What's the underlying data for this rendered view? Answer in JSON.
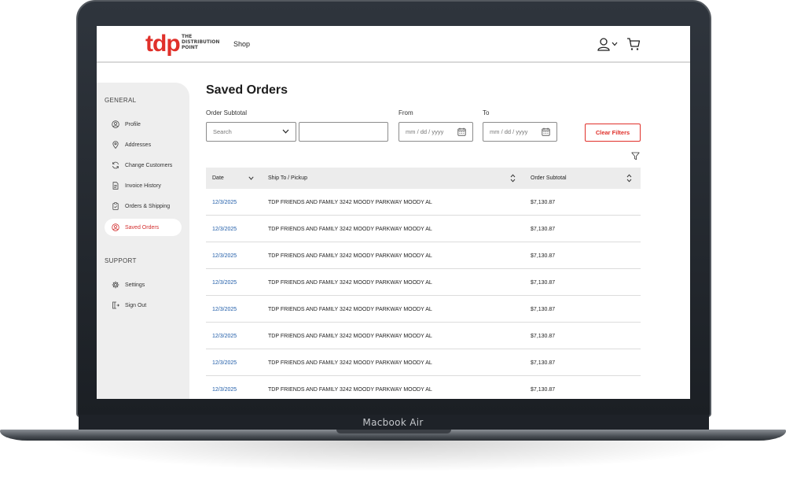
{
  "device": {
    "label": "Macbook Air"
  },
  "header": {
    "logo_mark": "tdp",
    "logo_text_line1": "THE",
    "logo_text_line2": "DISTRIBUTION",
    "logo_text_line3": "POINT",
    "shop_label": "Shop"
  },
  "sidebar": {
    "general_heading": "GENERAL",
    "support_heading": "SUPPORT",
    "items": [
      {
        "label": "Profile",
        "icon": "user-circle-icon"
      },
      {
        "label": "Addresses",
        "icon": "map-pin-icon"
      },
      {
        "label": "Change Customers",
        "icon": "refresh-icon"
      },
      {
        "label": "Invoice History",
        "icon": "document-icon"
      },
      {
        "label": "Orders & Shipping",
        "icon": "clipboard-icon"
      },
      {
        "label": "Saved Orders",
        "icon": "saved-orders-icon",
        "active": true
      }
    ],
    "support_items": [
      {
        "label": "Settings",
        "icon": "gear-icon"
      },
      {
        "label": "Sign Out",
        "icon": "sign-out-icon"
      }
    ]
  },
  "main": {
    "title": "Saved Orders",
    "filters": {
      "subtotal_label": "Order Subtotal",
      "search_placeholder": "Search",
      "from_label": "From",
      "to_label": "To",
      "date_placeholder": "mm / dd / yyyy",
      "clear_label": "Clear Filters"
    },
    "table": {
      "columns": [
        "Date",
        "Ship To / Pickup",
        "Order Subtotal"
      ],
      "rows": [
        {
          "date": "12/3/2025",
          "ship_to": "TDP FRIENDS AND FAMILY 3242 MOODY PARKWAY MOODY AL",
          "subtotal": "$7,130.87"
        },
        {
          "date": "12/3/2025",
          "ship_to": "TDP FRIENDS AND FAMILY 3242 MOODY PARKWAY MOODY AL",
          "subtotal": "$7,130.87"
        },
        {
          "date": "12/3/2025",
          "ship_to": "TDP FRIENDS AND FAMILY 3242 MOODY PARKWAY MOODY AL",
          "subtotal": "$7,130.87"
        },
        {
          "date": "12/3/2025",
          "ship_to": "TDP FRIENDS AND FAMILY 3242 MOODY PARKWAY MOODY AL",
          "subtotal": "$7,130.87"
        },
        {
          "date": "12/3/2025",
          "ship_to": "TDP FRIENDS AND FAMILY 3242 MOODY PARKWAY MOODY AL",
          "subtotal": "$7,130.87"
        },
        {
          "date": "12/3/2025",
          "ship_to": "TDP FRIENDS AND FAMILY 3242 MOODY PARKWAY MOODY AL",
          "subtotal": "$7,130.87"
        },
        {
          "date": "12/3/2025",
          "ship_to": "TDP FRIENDS AND FAMILY 3242 MOODY PARKWAY MOODY AL",
          "subtotal": "$7,130.87"
        },
        {
          "date": "12/3/2025",
          "ship_to": "TDP FRIENDS AND FAMILY 3242 MOODY PARKWAY MOODY AL",
          "subtotal": "$7,130.87"
        }
      ]
    }
  },
  "colors": {
    "brand": "#e0302a",
    "link": "#1f5ca8",
    "sidebar_bg": "#eeeeee"
  }
}
